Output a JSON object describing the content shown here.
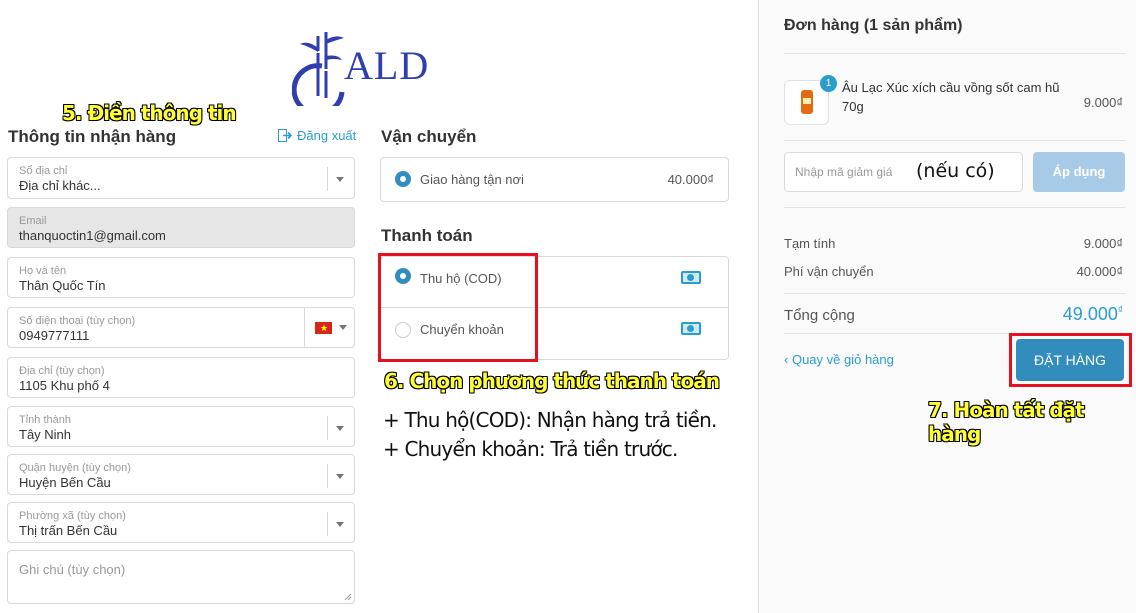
{
  "brand": {
    "logo_text": "ALD"
  },
  "annotations": {
    "step5": "5. Điền thông tin",
    "step6": "6. Chọn phương thức thanh toán",
    "step7": "7. Hoàn tất đặt hàng",
    "note_cod": "+ Thu hộ(COD): Nhận hàng trả tiền.",
    "note_transfer": "+ Chuyển khoản: Trả tiền trước.",
    "coupon_hint": "(nếu có)"
  },
  "shipping_info": {
    "title": "Thông tin nhận hàng",
    "logout_label": "Đăng xuất",
    "address_book": {
      "label": "Sổ địa chỉ",
      "value": "Địa chỉ khác..."
    },
    "email": {
      "label": "Email",
      "value": "thanquoctin1@gmail.com"
    },
    "name": {
      "label": "Họ và tên",
      "value": "Thân Quốc Tín"
    },
    "phone": {
      "label": "Số điện thoại (tùy chọn)",
      "value": "0949777111",
      "flag_icon": "vietnam-flag-icon"
    },
    "address": {
      "label": "Địa chỉ (tùy chọn)",
      "value": "1105 Khu phố 4"
    },
    "province": {
      "label": "Tỉnh thành",
      "value": "Tây Ninh"
    },
    "district": {
      "label": "Quận huyện (tùy chọn)",
      "value": "Huyện Bến Cầu"
    },
    "ward": {
      "label": "Phường xã (tùy chọn)",
      "value": "Thị trấn Bến Cầu"
    },
    "note": {
      "placeholder": "Ghi chú (tùy chọn)"
    }
  },
  "shipping": {
    "title": "Vận chuyển",
    "option": {
      "label": "Giao hàng tận nơi",
      "price": "40.000₫",
      "selected": true
    }
  },
  "payment": {
    "title": "Thanh toán",
    "options": [
      {
        "label": "Thu hộ (COD)",
        "selected": true,
        "icon": "cash-icon"
      },
      {
        "label": "Chuyển khoản",
        "selected": false,
        "icon": "cash-icon"
      }
    ]
  },
  "order": {
    "title": "Đơn hàng (1 sản phẩm)",
    "item": {
      "name": "Âu Lạc Xúc xích cầu vồng sốt cam hũ 70g",
      "qty": "1",
      "price": "9.000₫"
    },
    "coupon_placeholder": "Nhập mã giảm giá",
    "apply_label": "Áp dụng",
    "subtotal_label": "Tạm tính",
    "subtotal_value": "9.000₫",
    "shipping_fee_label": "Phí vận chuyển",
    "shipping_fee_value": "40.000₫",
    "total_label": "Tổng cộng",
    "total_value": "49.000",
    "total_currency": "₫",
    "back_label": "Quay về giỏ hàng",
    "submit_label": "ĐẶT HÀNG"
  },
  "colors": {
    "accent": "#338dbc",
    "link": "#2a9dcc",
    "highlight": "#e8101e",
    "annotation": "#ffff33"
  }
}
